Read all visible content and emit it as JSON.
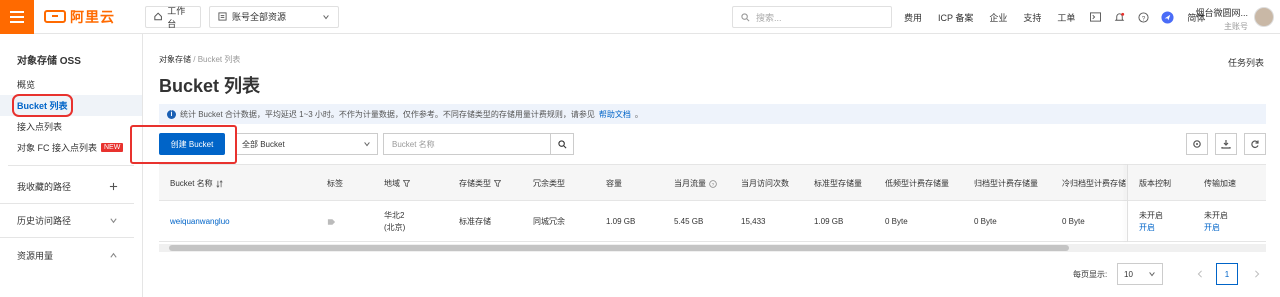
{
  "topbar": {
    "logo_text": "阿里云",
    "workbench": "工作台",
    "resource_group": "账号全部资源",
    "search_placeholder": "搜索...",
    "links": [
      "费用",
      "ICP 备案",
      "企业",
      "支持",
      "工单"
    ],
    "lang": "简体",
    "account_name": "烟台微圆网...",
    "account_role": "主账号"
  },
  "sidebar": {
    "title": "对象存储 OSS",
    "items": [
      {
        "label": "概览"
      },
      {
        "label": "Bucket 列表"
      },
      {
        "label": "接入点列表"
      },
      {
        "label": "对象 FC 接入点列表",
        "badge": "NEW"
      }
    ],
    "groups": [
      {
        "label": "我收藏的路径",
        "icon": "plus-icon"
      },
      {
        "label": "历史访问路径",
        "icon": "chevron-down-icon"
      },
      {
        "label": "资源用量",
        "icon": "chevron-up-icon"
      }
    ]
  },
  "main": {
    "breadcrumb": [
      "对象存储",
      "Bucket 列表"
    ],
    "task_link": "任务列表",
    "title": "Bucket 列表",
    "notice": {
      "text": "统计 Bucket 合计数据，平均延迟 1~3 小时。不作为计量数据，仅作参考。不同存储类型的存储用量计费规则，请参见",
      "link": "帮助文档",
      "end": "。"
    },
    "create_button": "创建 Bucket",
    "filter_select": "全部 Bucket",
    "name_placeholder": "Bucket 名称",
    "columns": [
      "Bucket 名称",
      "标签",
      "地域",
      "存储类型",
      "冗余类型",
      "容量",
      "当月流量",
      "当月访问次数",
      "标准型存储量",
      "低频型计费存储量",
      "归档型计费存储量",
      "冷归档型计费存储",
      "版本控制",
      "传输加速"
    ],
    "rows": [
      {
        "name": "weiquanwangluo",
        "region_line1": "华北2",
        "region_line2": "(北京)",
        "storage_type": "标准存储",
        "redundancy": "同城冗余",
        "capacity": "1.09 GB",
        "traffic": "5.45 GB",
        "visits": "15,433",
        "standard": "1.09 GB",
        "ia": "0 Byte",
        "archive": "0 Byte",
        "cold": "0 Byte",
        "versioning_status": "未开启",
        "versioning_action": "开启",
        "accel_status": "未开启",
        "accel_action": "开启"
      }
    ],
    "pagination": {
      "label": "每页显示:",
      "page_size": "10",
      "current_page": "1"
    }
  },
  "colors": {
    "brand": "#ff6a00",
    "primary": "#0064c8",
    "highlight": "#e8322e"
  }
}
